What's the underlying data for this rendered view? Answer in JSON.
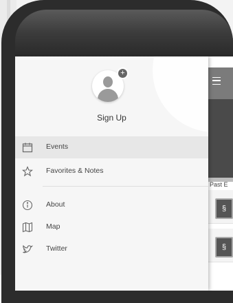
{
  "drawer": {
    "sign_up_label": "Sign Up",
    "items": [
      {
        "label": "Events",
        "icon": "calendar-icon",
        "active": true
      },
      {
        "label": "Favorites & Notes",
        "icon": "star-icon"
      },
      {
        "label": "About",
        "icon": "info-icon"
      },
      {
        "label": "Map",
        "icon": "map-icon"
      },
      {
        "label": "Twitter",
        "icon": "twitter-icon"
      }
    ]
  },
  "app": {
    "past_events_label": "Past E"
  },
  "colors": {
    "drawer_bg": "#f6f6f6",
    "active_item_bg": "#e7e7e7",
    "header_bg": "#7b7b7b",
    "banner_bg": "#4a4a4a"
  }
}
